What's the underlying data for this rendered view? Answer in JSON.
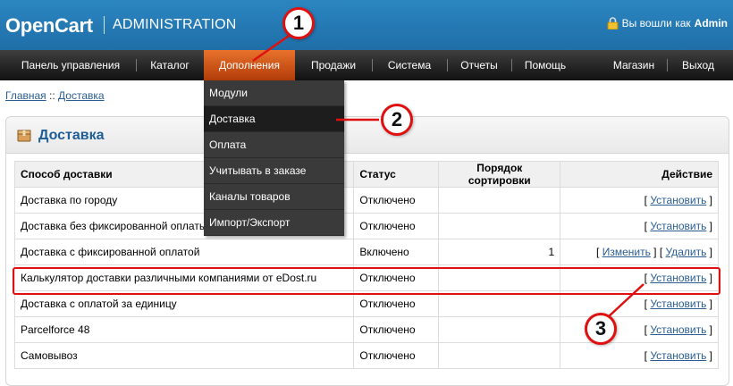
{
  "header": {
    "logo": "OpenCart",
    "admin_label": "ADMINISTRATION",
    "login_text": "Вы вошли как",
    "login_user": "Admin"
  },
  "menu": {
    "items": [
      "Панель управления",
      "Каталог",
      "Дополнения",
      "Продажи",
      "Система",
      "Отчеты",
      "Помощь"
    ],
    "right_items": [
      "Магазин",
      "Выход"
    ],
    "active": "Дополнения"
  },
  "dropdown": {
    "items": [
      "Модули",
      "Доставка",
      "Оплата",
      "Учитывать в заказе",
      "Каналы товаров",
      "Импорт/Экспорт"
    ],
    "highlighted": "Доставка"
  },
  "breadcrumb": {
    "home": "Главная",
    "separator": "::",
    "current": "Доставка"
  },
  "panel": {
    "title": "Доставка"
  },
  "table": {
    "headers": [
      "Способ доставки",
      "Статус",
      "Порядок сортировки",
      "Действие"
    ],
    "rows": [
      {
        "name": "Доставка по городу",
        "status": "Отключено",
        "order": "",
        "actions": [
          "Установить"
        ]
      },
      {
        "name": "Доставка без фиксированной оплаты",
        "status": "Отключено",
        "order": "",
        "actions": [
          "Установить"
        ]
      },
      {
        "name": "Доставка с фиксированной оплатой",
        "status": "Включено",
        "order": "1",
        "actions": [
          "Изменить",
          "Удалить"
        ]
      },
      {
        "name": "Калькулятор доставки различными компаниями от eDost.ru",
        "status": "Отключено",
        "order": "",
        "actions": [
          "Установить"
        ]
      },
      {
        "name": "Доставка с оплатой за единицу",
        "status": "Отключено",
        "order": "",
        "actions": [
          "Установить"
        ]
      },
      {
        "name": "Parcelforce 48",
        "status": "Отключено",
        "order": "",
        "actions": [
          "Установить"
        ]
      },
      {
        "name": "Самовывоз",
        "status": "Отключено",
        "order": "",
        "actions": [
          "Установить"
        ]
      }
    ]
  },
  "markers": [
    "1",
    "2",
    "3"
  ],
  "colors": {
    "accent_red": "#e01010",
    "header_blue": "#2178b5",
    "menu_active": "#d4561a",
    "link": "#2a5d92"
  }
}
